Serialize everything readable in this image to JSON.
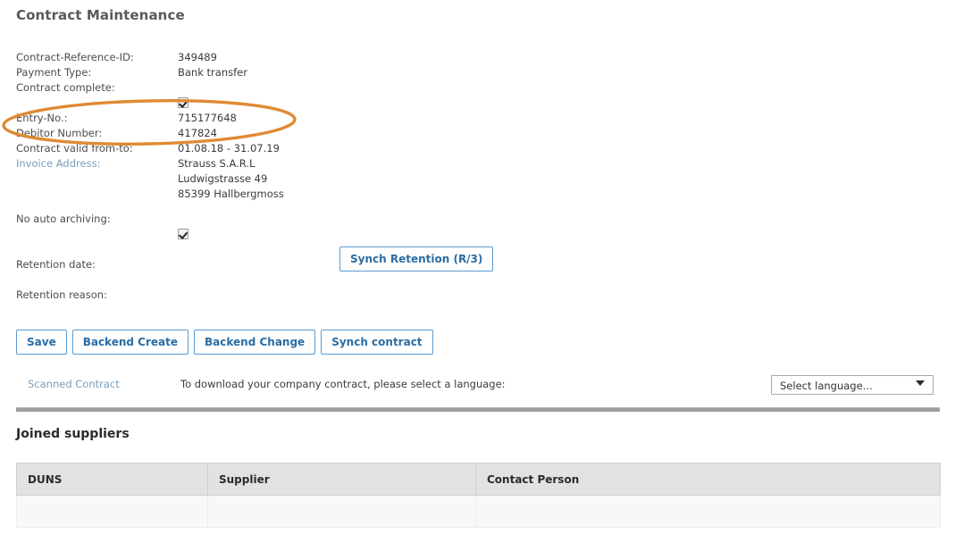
{
  "page": {
    "title": "Contract Maintenance"
  },
  "details": {
    "rows": [
      {
        "label": "Contract-Reference-ID:",
        "value": "349489",
        "type": "text"
      },
      {
        "label": "Payment Type:",
        "value": "Bank transfer",
        "type": "text"
      },
      {
        "label": "Contract complete:",
        "value": "",
        "type": "checkbox",
        "checked": true
      },
      {
        "label": "Entry-No.:",
        "value": "715177648",
        "type": "text"
      },
      {
        "label": "Debitor Number:",
        "value": "417824",
        "type": "text"
      },
      {
        "label": "Contract valid from-to:",
        "value": "01.08.18 - 31.07.19",
        "type": "text"
      },
      {
        "label": "Invoice Address:",
        "value": "Strauss S.A.R.L\nLudwigstrasse 49\n85399  Hallbergmoss",
        "type": "address"
      },
      {
        "label": "No auto archiving:",
        "value": "",
        "type": "checkbox",
        "checked": true
      }
    ]
  },
  "retention": {
    "date_label": "Retention date:",
    "date_value": "",
    "reason_label": "Retention reason:",
    "reason_value": "",
    "synch_retention_button": "Synch Retention (R/3)"
  },
  "actions": {
    "buttons": [
      {
        "label": "Save",
        "name": "save-button"
      },
      {
        "label": "Backend Create",
        "name": "backend-create-button"
      },
      {
        "label": "Backend Change",
        "name": "backend-change-button"
      },
      {
        "label": "Synch contract",
        "name": "synch-contract-button"
      }
    ]
  },
  "download": {
    "scanned_contract_link": "Scanned Contract",
    "instruction": "To download your company contract, please select a language:",
    "language_select": {
      "selected": "Select language...",
      "options": [
        "Select language..."
      ]
    }
  },
  "joined_suppliers": {
    "title": "Joined suppliers",
    "columns": [
      "DUNS",
      "Supplier",
      "Contact Person"
    ],
    "rows": [
      {
        "duns": "",
        "supplier": "",
        "contact_person": ""
      }
    ]
  },
  "annotation": {
    "shape": "ellipse",
    "color": "#E08A33",
    "targets": "Entry-No.: 715177648"
  }
}
